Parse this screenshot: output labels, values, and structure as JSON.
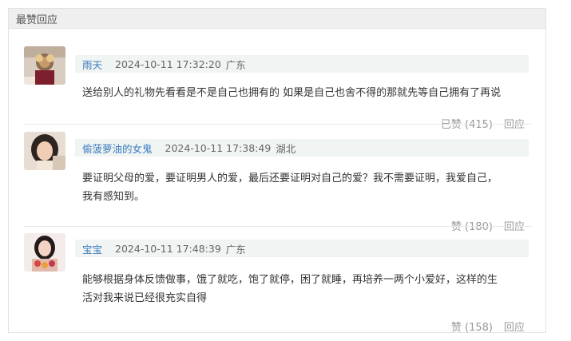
{
  "panel": {
    "title": "最赞回应"
  },
  "comments": [
    {
      "username": "雨天",
      "time": "2024-10-11 17:32:20",
      "location": "广东",
      "lines": [
        "送给别人的礼物先看看是不是自己也拥有的 如果是自己也舍不得的那就先等自己拥有了再说"
      ],
      "like_label": "已赞",
      "like_count": "(415)",
      "reply_label": "回应"
    },
    {
      "username": "偷菠萝油的女鬼",
      "time": "2024-10-11 17:38:49",
      "location": "湖北",
      "lines": [
        "要证明父母的爱，要证明男人的爱，最后还要证明对自己的爱？我不需要证明，我爱自己，",
        "我有感知到。"
      ],
      "like_label": "赞",
      "like_count": "(180)",
      "reply_label": "回应"
    },
    {
      "username": "宝宝",
      "time": "2024-10-11 17:48:39",
      "location": "广东",
      "lines": [
        "能够根据身体反馈做事，饿了就吃，饱了就停，困了就睡，再培养一两个小爱好，这样的生",
        "活对我来说已经很充实自得"
      ],
      "like_label": "赞",
      "like_count": "(158)",
      "reply_label": "回应"
    }
  ]
}
